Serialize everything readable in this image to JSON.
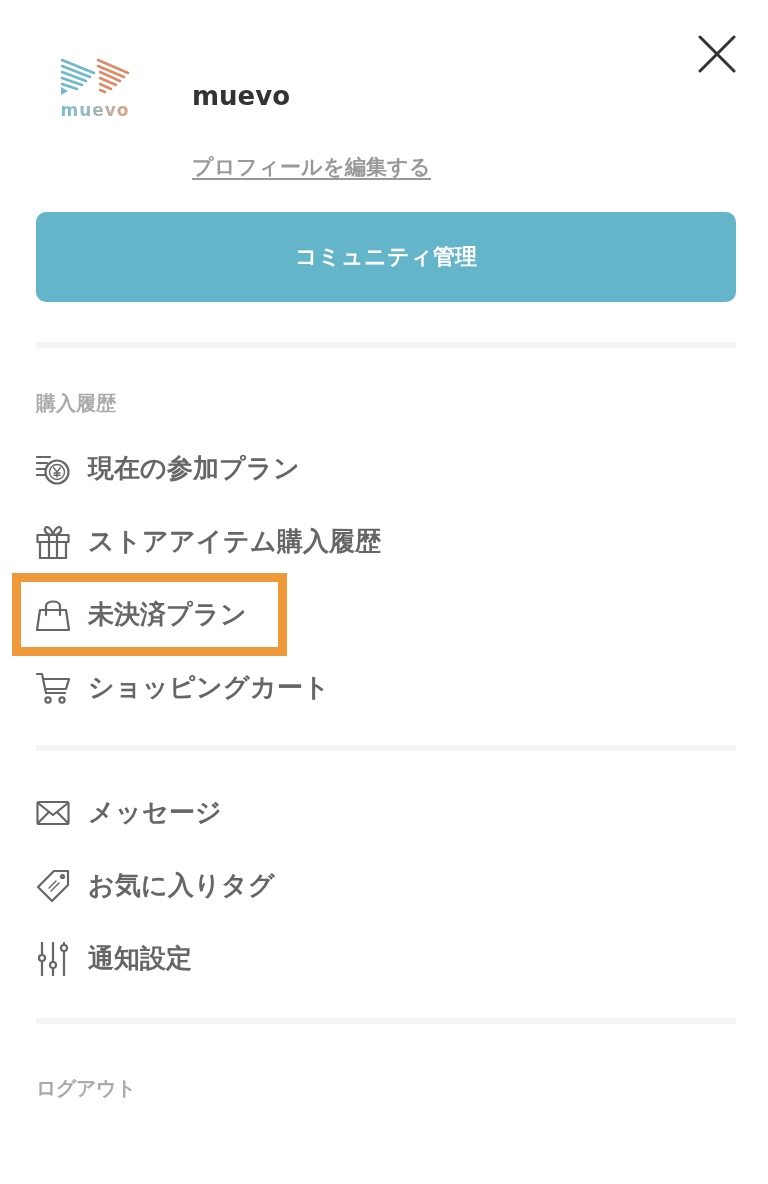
{
  "header": {
    "logo_text": "muevo",
    "name": "muevo",
    "edit_profile_link": "プロフィールを編集する"
  },
  "primary_button": "コミュニティ管理",
  "sections": [
    {
      "heading": "購入履歴",
      "items": [
        {
          "label": "現在の参加プラン",
          "kind": "plan",
          "highlighted": false
        },
        {
          "label": "ストアアイテム購入履歴",
          "kind": "gift",
          "highlighted": false
        },
        {
          "label": "未決済プラン",
          "kind": "bag",
          "highlighted": true
        },
        {
          "label": "ショッピングカート",
          "kind": "cart",
          "highlighted": false
        }
      ]
    },
    {
      "items": [
        {
          "label": "メッセージ",
          "kind": "mail",
          "highlighted": false
        },
        {
          "label": "お気に入りタグ",
          "kind": "tag",
          "highlighted": false
        },
        {
          "label": "通知設定",
          "kind": "sliders",
          "highlighted": false
        }
      ]
    }
  ],
  "logout": "ログアウト"
}
